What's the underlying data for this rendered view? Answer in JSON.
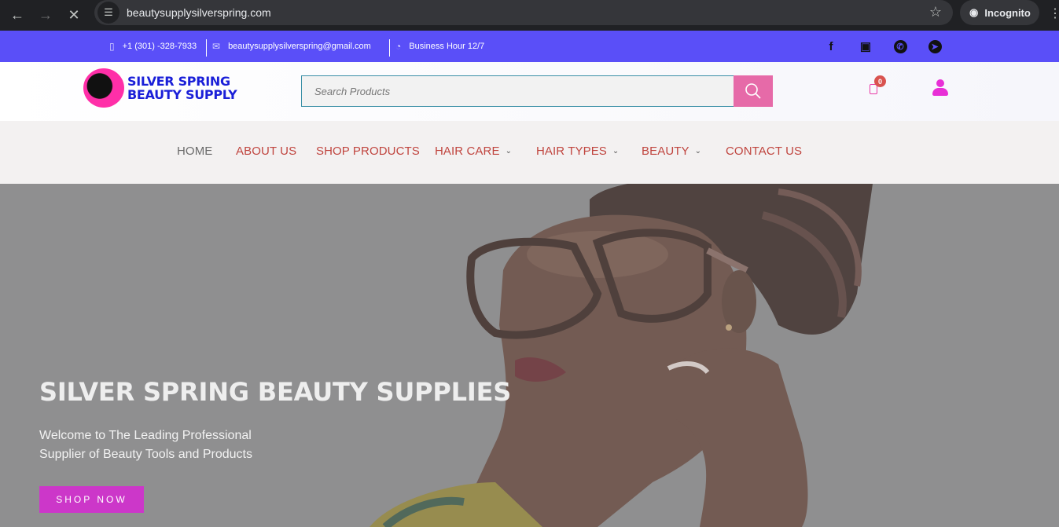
{
  "browser": {
    "url": "beautysupplysilverspring.com",
    "profile_label": "Incognito"
  },
  "topbar": {
    "phone": "+1 (301) -328-7933",
    "email": "beautysupplysilverspring@gmail.com",
    "hours": "Business Hour 12/7",
    "socials": [
      "facebook-icon",
      "instagram-icon",
      "whatsapp-icon",
      "telegram-icon"
    ]
  },
  "header": {
    "logo_line1": "SILVER SPRING",
    "logo_line2": "BEAUTY SUPPLY",
    "search_placeholder": "Search Products",
    "cart_count": "0"
  },
  "nav": {
    "items": [
      {
        "label": "HOME"
      },
      {
        "label": "ABOUT US"
      },
      {
        "label": "SHOP PRODUCTS"
      },
      {
        "label": "HAIR CARE"
      },
      {
        "label": "HAIR TYPES"
      },
      {
        "label": "BEAUTY"
      },
      {
        "label": "CONTACT US"
      }
    ]
  },
  "hero": {
    "title": "SILVER SPRING BEAUTY SUPPLIES",
    "subtitle_line1": "Welcome to The Leading Professional",
    "subtitle_line2": "Supplier of Beauty Tools and Products",
    "cta": "SHOP NOW"
  },
  "colors": {
    "topbar_bg": "#5a4ff8",
    "nav_text": "#c0453f",
    "search_button": "#e66aa8",
    "cta_bg": "#cc37c9",
    "account_icon": "#e82fd6"
  }
}
